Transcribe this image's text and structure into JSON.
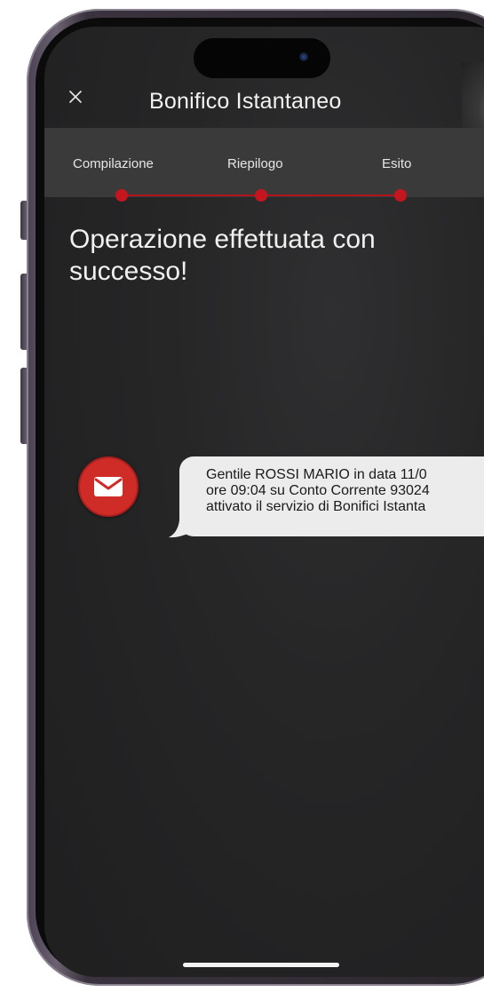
{
  "header": {
    "title": "Bonifico Istantaneo",
    "close_icon": "close-icon"
  },
  "steps": [
    {
      "label": "Compilazione",
      "state": "done"
    },
    {
      "label": "Riepilogo",
      "state": "done"
    },
    {
      "label": "Esito",
      "state": "current"
    }
  ],
  "result": {
    "message": "Operazione effettuata con successo!"
  },
  "notification": {
    "icon": "envelope-icon",
    "lines": [
      "Gentile ROSSI MARIO in data 11/0",
      "ore 09:04 su Conto Corrente 93024",
      "attivato il servizio di Bonifici Istanta"
    ]
  },
  "colors": {
    "accent": "#c4161e",
    "background": "#262627",
    "steps_bar": "#3a3a3b",
    "bubble": "#ececec"
  }
}
